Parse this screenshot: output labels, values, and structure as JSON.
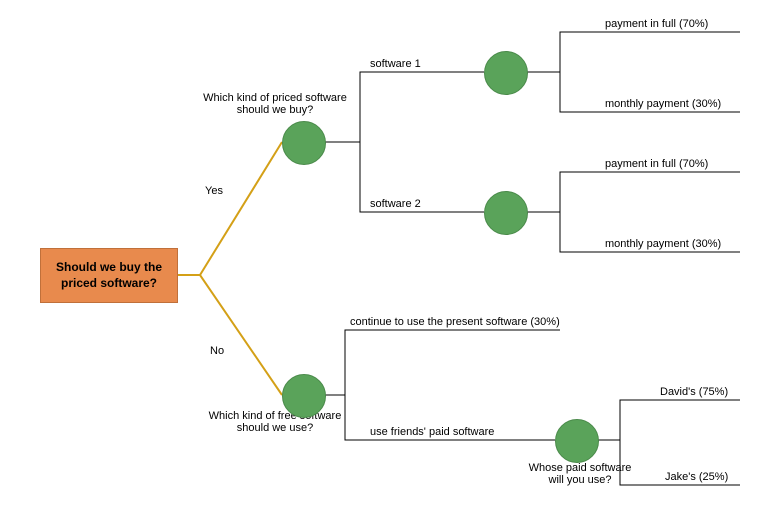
{
  "root": {
    "text": "Should we buy the priced software?"
  },
  "yesBranch": {
    "edgeLabel": "Yes",
    "question": "Which kind of priced software should we buy?",
    "sw1": {
      "label": "software 1",
      "leaf1": "payment in full (70%)",
      "leaf2": "monthly payment (30%)"
    },
    "sw2": {
      "label": "software 2",
      "leaf1": "payment in full (70%)",
      "leaf2": "monthly payment (30%)"
    }
  },
  "noBranch": {
    "edgeLabel": "No",
    "question": "Which kind of free software should we use?",
    "continue": "continue to use the present software (30%)",
    "friends": {
      "label": "use friends' paid software",
      "question": "Whose paid software will you use?",
      "leaf1": "David's (75%)",
      "leaf2": "Jake's (25%)"
    }
  }
}
